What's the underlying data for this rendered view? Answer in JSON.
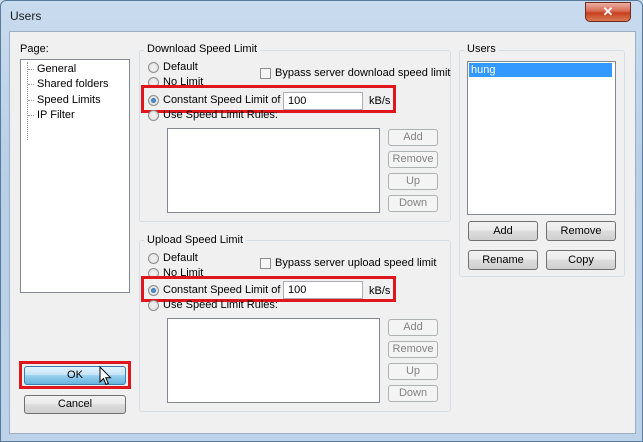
{
  "window": {
    "title": "Users",
    "close_glyph": "✕"
  },
  "page_panel": {
    "label": "Page:",
    "items": [
      "General",
      "Shared folders",
      "Speed Limits",
      "IP Filter"
    ]
  },
  "download": {
    "group_title": "Download Speed Limit",
    "default_label": "Default",
    "no_limit_label": "No Limit",
    "bypass_label": "Bypass server download speed limit",
    "constant_label": "Constant Speed Limit of",
    "constant_value": "100",
    "unit": "kB/s",
    "rules_label": "Use Speed Limit Rules:",
    "selected": "Constant Speed Limit of"
  },
  "upload": {
    "group_title": "Upload Speed Limit",
    "default_label": "Default",
    "no_limit_label": "No Limit",
    "bypass_label": "Bypass server upload speed limit",
    "constant_label": "Constant Speed Limit of",
    "constant_value": "100",
    "unit": "kB/s",
    "rules_label": "Use Speed Limit Rules:",
    "selected": "Constant Speed Limit of"
  },
  "rule_buttons": {
    "add": "Add",
    "remove": "Remove",
    "up": "Up",
    "down": "Down"
  },
  "users_panel": {
    "label": "Users",
    "users": [
      "hung"
    ],
    "add": "Add",
    "remove": "Remove",
    "rename": "Rename",
    "copy": "Copy"
  },
  "footer": {
    "ok": "OK",
    "cancel": "Cancel"
  },
  "colors": {
    "highlight": "#e0161d",
    "selection": "#3399ff"
  }
}
